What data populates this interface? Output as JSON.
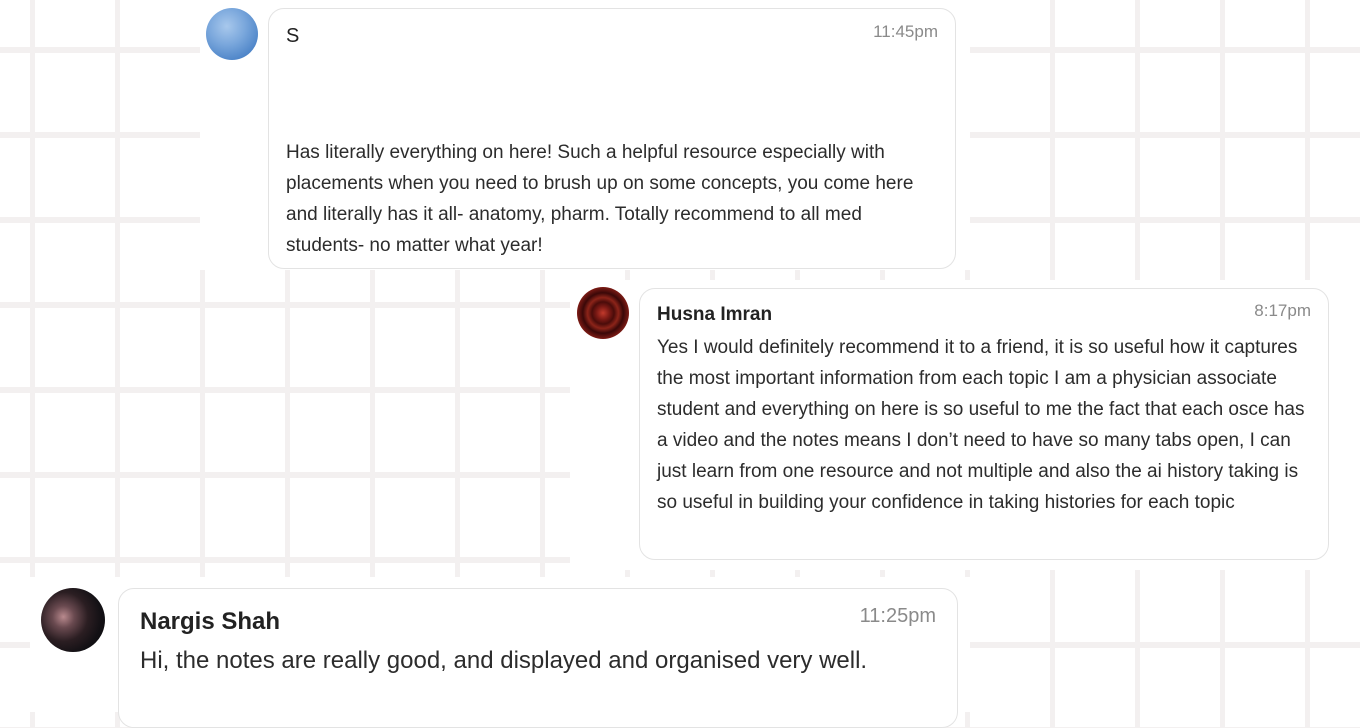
{
  "messages": [
    {
      "name": "S",
      "time": "11:45pm",
      "text": " Has literally everything on here! Such a helpful resource especially with placements when you need to brush up on some concepts, you come here and literally has it all- anatomy, pharm. Totally recommend to all med students- no matter what year!"
    },
    {
      "name": "Husna Imran",
      "time": "8:17pm",
      "text": "Yes I would definitely recommend it to a friend, it is so useful how it captures the most important information from each topic I am a physician associate student and everything on here is so useful to me the fact that each osce has a video and the notes means I don’t need to have so many tabs open, I can just learn from one resource and not multiple and also the ai history taking is so useful in building your confidence in taking histories for each topic"
    },
    {
      "name": "Nargis Shah",
      "time": "11:25pm",
      "text": "Hi, the notes are really good, and displayed and organised very well."
    }
  ],
  "colors": {
    "background": "#ffffff",
    "grid_line": "#f3f0f0",
    "bubble_border": "#e3e3e3",
    "time_text": "#8a8a8a"
  }
}
